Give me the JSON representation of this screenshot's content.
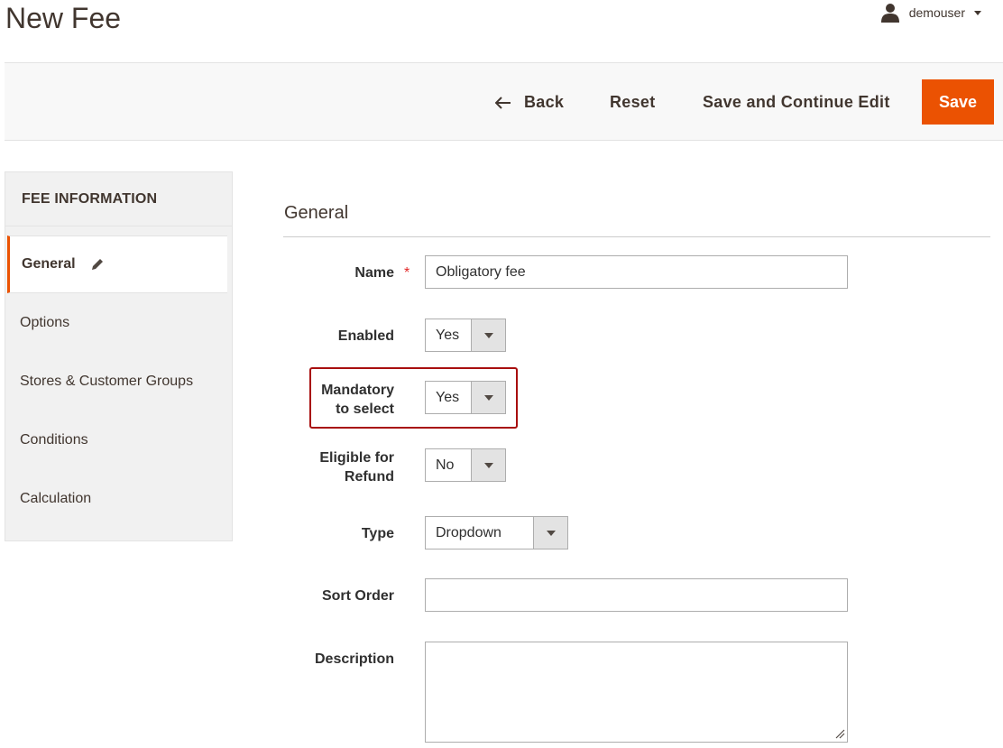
{
  "header": {
    "title": "New Fee",
    "username": "demouser"
  },
  "actions": {
    "back_label": "Back",
    "reset_label": "Reset",
    "save_continue_label": "Save and Continue Edit",
    "save_label": "Save",
    "save_color": "#eb5202"
  },
  "sidebar": {
    "heading": "FEE INFORMATION",
    "items": [
      {
        "label": "General",
        "active": true
      },
      {
        "label": "Options"
      },
      {
        "label": "Stores & Customer Groups"
      },
      {
        "label": "Conditions"
      },
      {
        "label": "Calculation"
      }
    ]
  },
  "form": {
    "section_title": "General",
    "name": {
      "label": "Name",
      "value": "Obligatory fee",
      "required": true
    },
    "enabled": {
      "label": "Enabled",
      "value": "Yes"
    },
    "mandatory": {
      "label_line1": "Mandatory",
      "label_line2": "to select",
      "value": "Yes"
    },
    "refund": {
      "label_line1": "Eligible for",
      "label_line2": "Refund",
      "value": "No"
    },
    "type": {
      "label": "Type",
      "value": "Dropdown"
    },
    "sort_order": {
      "label": "Sort Order",
      "value": ""
    },
    "description": {
      "label": "Description",
      "value": ""
    }
  },
  "icons": {
    "user": "user-icon",
    "back": "arrow-left-icon",
    "edit": "pencil-icon",
    "dropdown": "triangle-down-icon"
  },
  "highlight_color": "#a80f0f"
}
